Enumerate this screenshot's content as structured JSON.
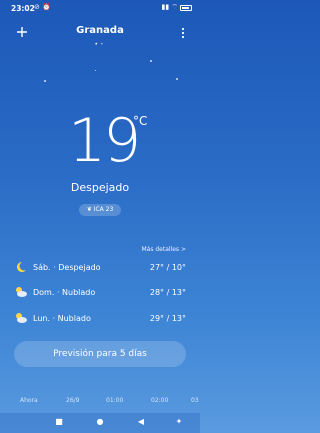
{
  "status_bar": {
    "time": "23:02",
    "icons_left": "⊘ ⏰",
    "icons_right": "▮▮ ⌔"
  },
  "header": {
    "city": "Granada",
    "add_icon": "plus-icon",
    "menu_icon": "more-vertical-icon",
    "page_dots": [
      "•",
      "•"
    ]
  },
  "current": {
    "temperature": "19",
    "unit": "°C",
    "condition": "Despejado",
    "aqi": "ICA 23"
  },
  "forecast": {
    "more_details": "Más detalles >",
    "days": [
      {
        "label": "Sáb. · Despejado",
        "temps": "27° / 10°",
        "icon": "moon-icon"
      },
      {
        "label": "Dom. · Nublado",
        "temps": "28° / 13°",
        "icon": "partly-cloudy-icon"
      },
      {
        "label": "Lun. · Nublado",
        "temps": "29° / 13°",
        "icon": "partly-cloudy-icon"
      }
    ],
    "button": "Previsión para 5 días"
  },
  "hourly": {
    "labels": [
      "Ahora",
      "26/9",
      "01:00",
      "02:00",
      "03"
    ]
  },
  "colors": {
    "background_top": "#1d58b8",
    "background_bottom": "#5a9be0",
    "sun": "#ffd54a"
  }
}
